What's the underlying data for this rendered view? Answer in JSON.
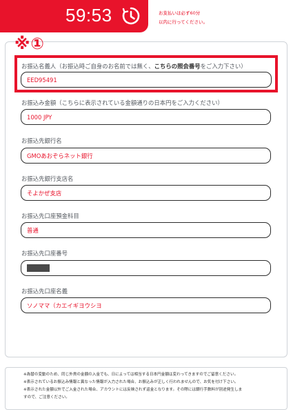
{
  "timer": {
    "time": "59:53",
    "note_line1": "お支払いは必ず60分",
    "note_line2": "以内に行ってください。"
  },
  "marker": "※①",
  "fields": [
    {
      "label_prefix": "お振込名義人（お振込時ご自身のお名前では無く、",
      "label_bold": "こちらの照会番号",
      "label_suffix": "をご入力下さい）",
      "value": "EED95491"
    },
    {
      "label": "お振込み金額（こちらに表示されている金額通りの日本円をご入力ください）",
      "value": "1000 JPY"
    },
    {
      "label": "お振込先銀行名",
      "value": "GMOあおぞらネット銀行"
    },
    {
      "label": "お振込先銀行支店名",
      "value": "そよかぜ支店"
    },
    {
      "label": "お振込先口座預金科目",
      "value": "普通"
    },
    {
      "label": "お振込先口座番号",
      "value": ""
    },
    {
      "label": "お振込先口座名義",
      "value": "ソノママ（カエイギヨウシヨ"
    }
  ],
  "notes": [
    "※為替の変動のため、同じ外貨の金額の入金でも、日によっては相当する日本円金額は変わってきますのでご留意ください。",
    "※表示されているお振込み情報と異なった情報が入力された場合、お振込みが正しく行われませんので、お気を付け下さい。",
    "※表示された金額以外でご入金された場合、アカウントには反映されず返金となります。その際には銀行手数料が別途発生しま",
    "すので、ご注意ください。"
  ],
  "colors": {
    "accent": "#e8132b",
    "label": "#555a60",
    "border": "#cfd3d8"
  },
  "icons": {
    "timer": "clock-icon"
  }
}
